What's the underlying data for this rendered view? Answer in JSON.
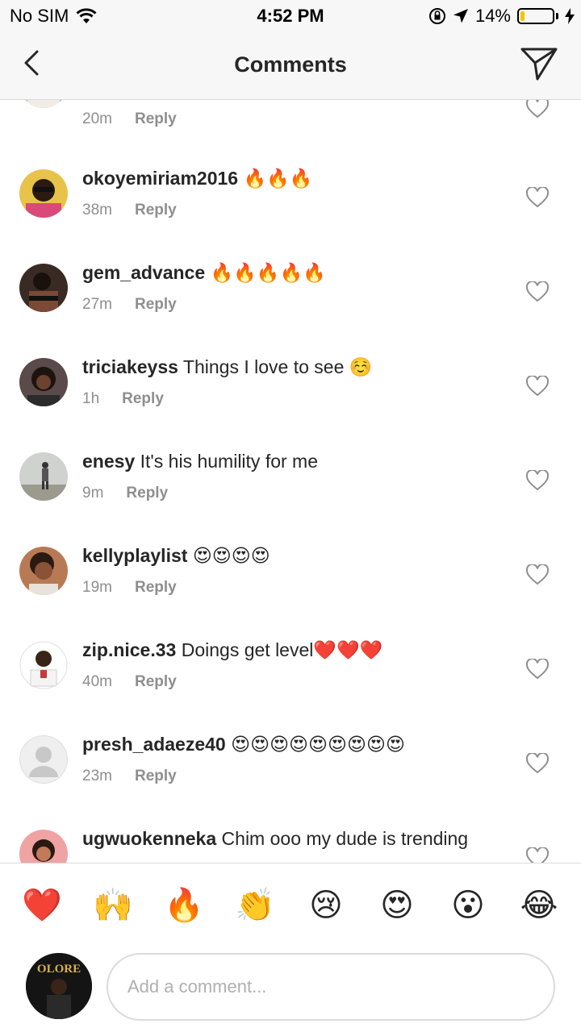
{
  "status_bar": {
    "carrier": "No SIM",
    "time": "4:52 PM",
    "battery_percent": "14%",
    "battery_level": 0.14,
    "battery_color": "#f5c400"
  },
  "header": {
    "title": "Comments",
    "back_icon": "chevron-left-icon",
    "send_icon": "paper-plane-icon"
  },
  "reply_label": "Reply",
  "comments": [
    {
      "username": "",
      "text": "",
      "time": "20m"
    },
    {
      "username": "okoyemiriam2016",
      "text": "🔥🔥🔥",
      "time": "38m"
    },
    {
      "username": "gem_advance",
      "text": "🔥🔥🔥🔥🔥",
      "time": "27m"
    },
    {
      "username": "triciakeyss",
      "text": "Things I love to see ☺️",
      "time": "1h"
    },
    {
      "username": "enesy",
      "text": "It's his humility for me",
      "time": "9m"
    },
    {
      "username": "kellyplaylist",
      "text": "😍😍😍😍",
      "time": "19m"
    },
    {
      "username": "zip.nice.33",
      "text": "Doings get level❤️❤️❤️",
      "time": "40m"
    },
    {
      "username": "presh_adaeze40",
      "text": "😍😍😍😍😍😍😍😍😍",
      "time": "23m"
    },
    {
      "username": "ugwuokenneka",
      "text": "Chim ooo my dude is trending",
      "time": ""
    }
  ],
  "reactions": [
    "❤️",
    "🙌",
    "🔥",
    "👏",
    "😢",
    "😍",
    "😮",
    "😂"
  ],
  "composer": {
    "placeholder": "Add a comment...",
    "avatar_text": "OLORE"
  }
}
